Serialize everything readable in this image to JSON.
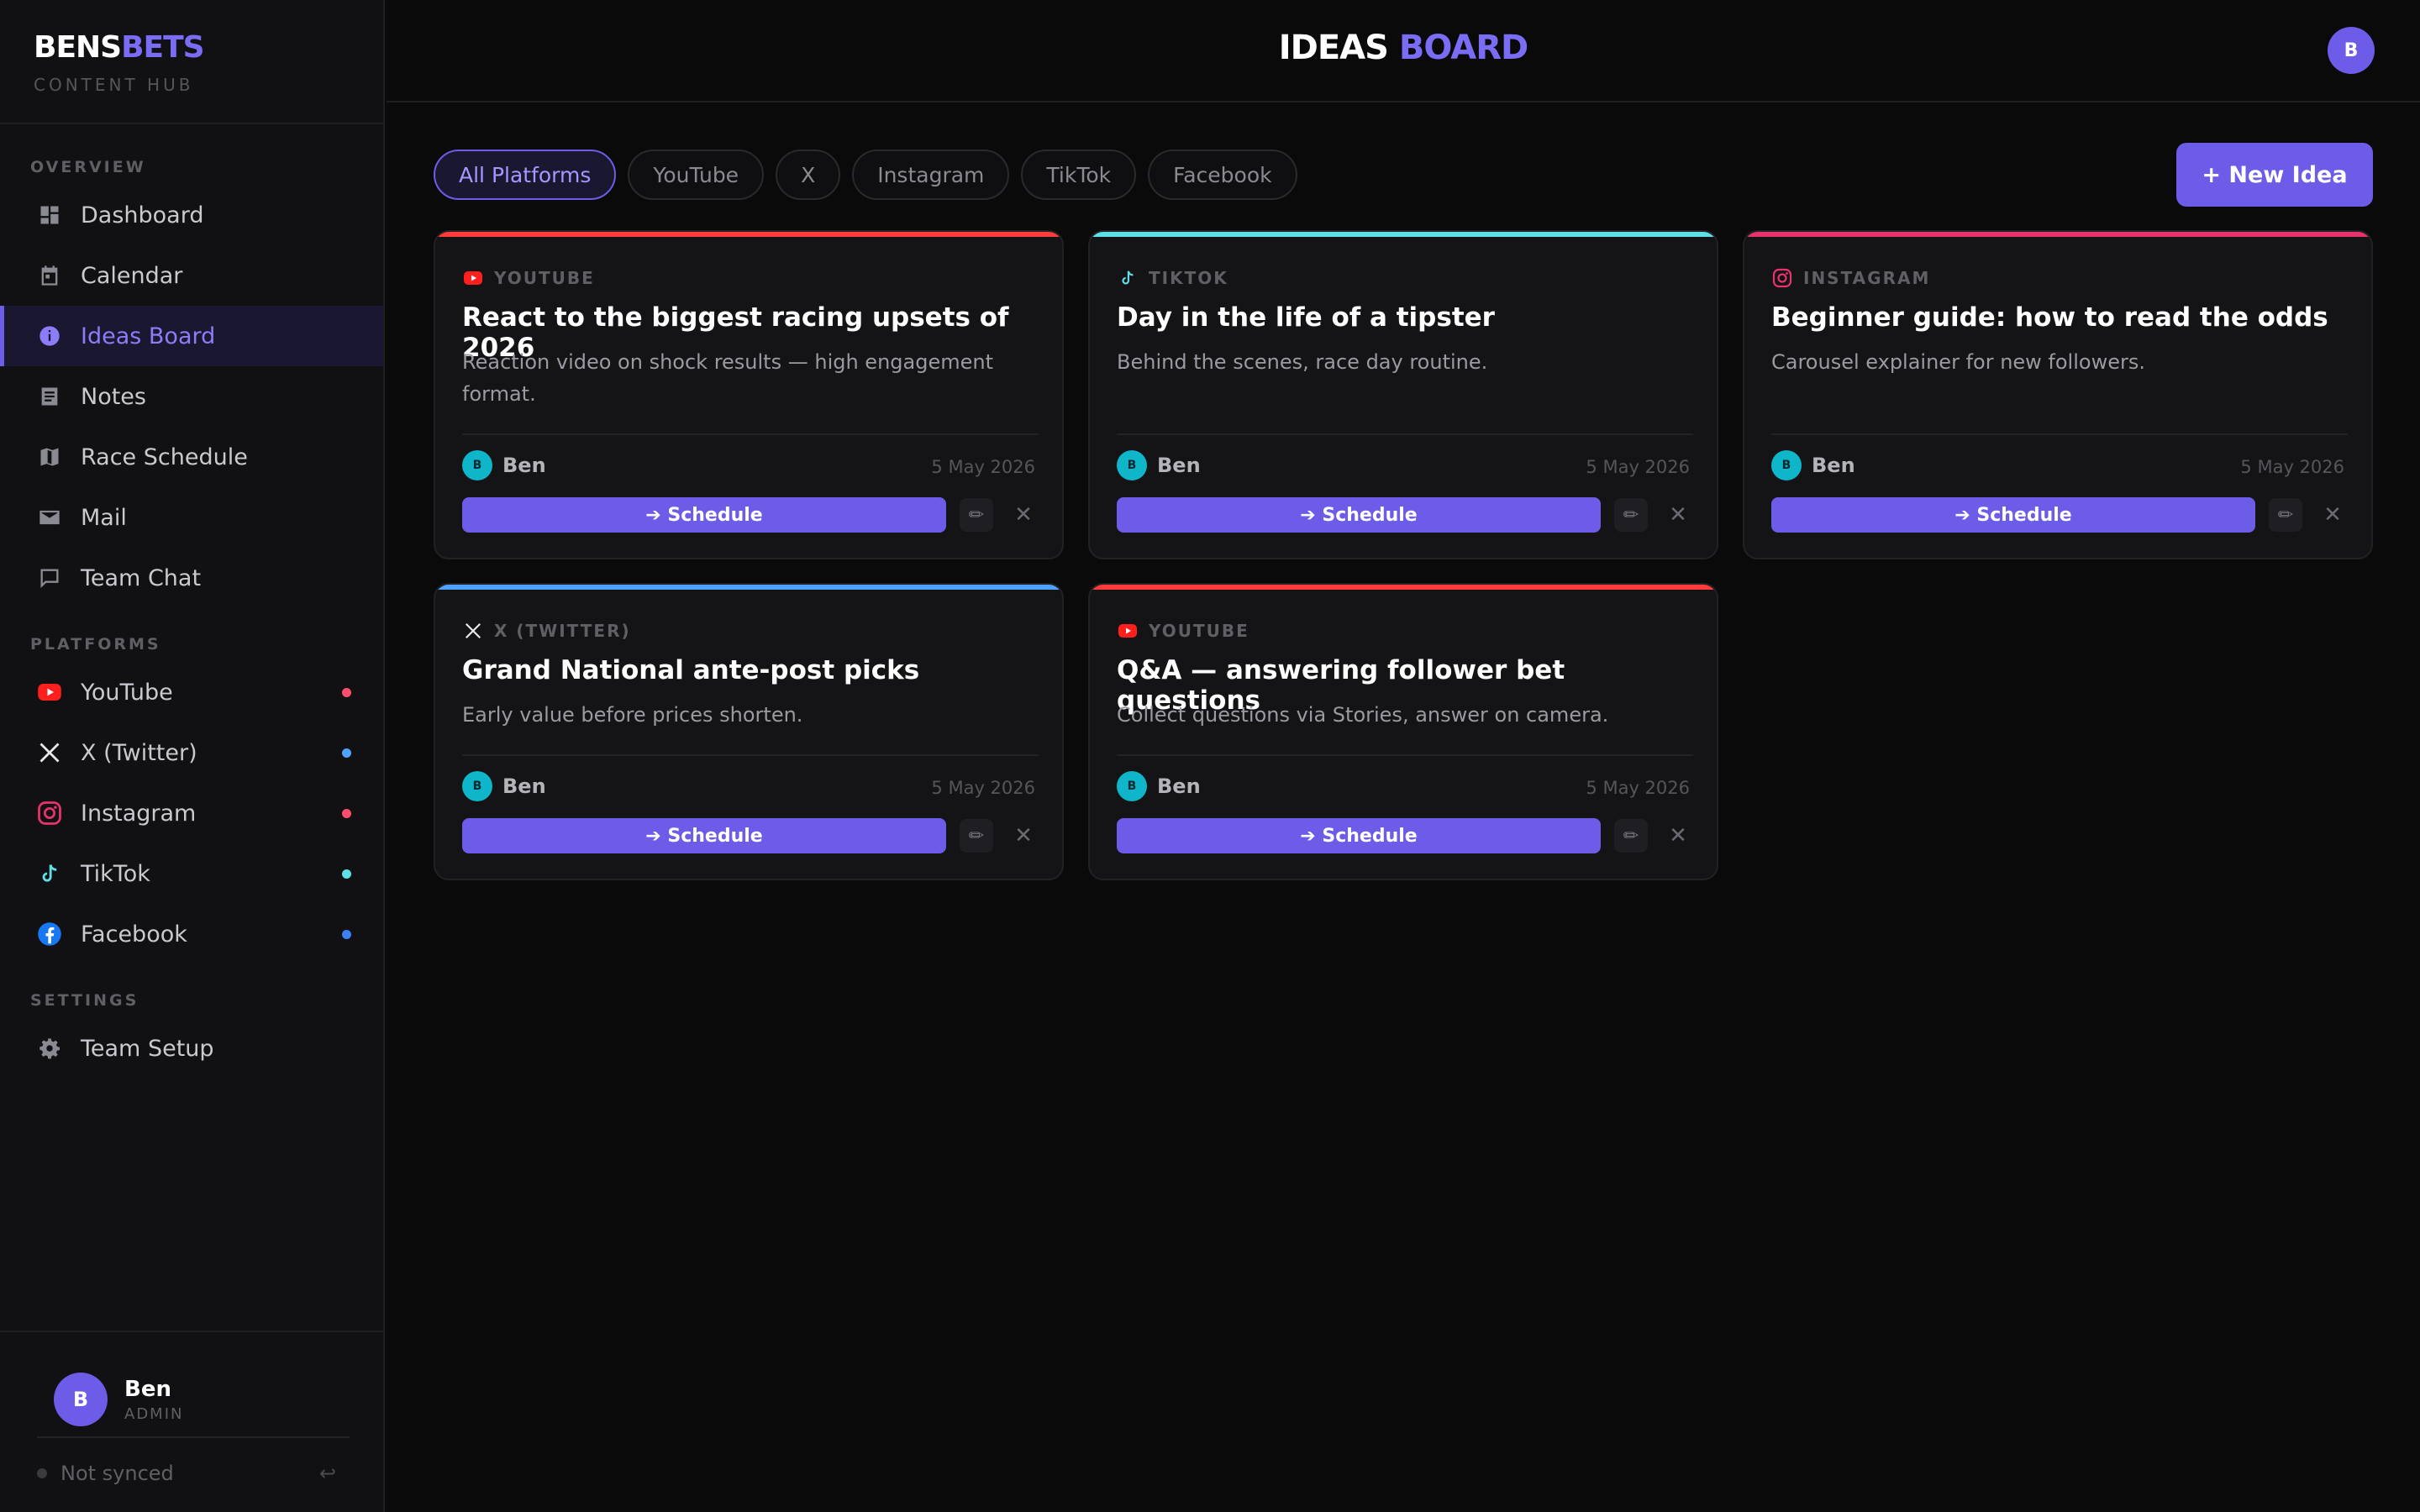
{
  "brand": {
    "name_a": "BENS",
    "name_b": "BETS",
    "subtitle": "CONTENT HUB"
  },
  "sidebar": {
    "sections": {
      "overview": "OVERVIEW",
      "platforms": "PLATFORMS",
      "settings": "SETTINGS"
    },
    "overview_items": [
      {
        "label": "Dashboard",
        "icon": "dashboard-icon"
      },
      {
        "label": "Calendar",
        "icon": "calendar-icon"
      },
      {
        "label": "Ideas Board",
        "icon": "info-icon",
        "active": true
      },
      {
        "label": "Notes",
        "icon": "notes-icon"
      },
      {
        "label": "Race Schedule",
        "icon": "map-icon"
      },
      {
        "label": "Mail",
        "icon": "mail-icon"
      },
      {
        "label": "Team Chat",
        "icon": "chat-icon"
      }
    ],
    "platform_items": [
      {
        "label": "YouTube",
        "icon": "youtube-icon",
        "dot_color": "#ff4d6d"
      },
      {
        "label": "X (Twitter)",
        "icon": "x-icon",
        "dot_color": "#4da3ff"
      },
      {
        "label": "Instagram",
        "icon": "instagram-icon",
        "dot_color": "#ff4d6d"
      },
      {
        "label": "TikTok",
        "icon": "tiktok-icon",
        "dot_color": "#5ee0e6"
      },
      {
        "label": "Facebook",
        "icon": "facebook-icon",
        "dot_color": "#3b82f6"
      }
    ],
    "settings_items": [
      {
        "label": "Team Setup",
        "icon": "gear-icon"
      }
    ],
    "user": {
      "initial": "B",
      "name": "Ben",
      "role": "ADMIN"
    },
    "sync_status": "Not synced"
  },
  "header": {
    "title_a": "IDEAS",
    "title_b": "BOARD",
    "avatar_initial": "B"
  },
  "filters": {
    "chips": [
      "All Platforms",
      "YouTube",
      "X",
      "Instagram",
      "TikTok",
      "Facebook"
    ],
    "active": "All Platforms"
  },
  "new_idea_label": "+ New Idea",
  "colors": {
    "accent": "#6c5ce7",
    "youtube": "#ff3b3b",
    "tiktok": "#5ee0e6",
    "instagram": "#e6336b",
    "x": "#4da3ff",
    "facebook": "#1877f2"
  },
  "cards": [
    {
      "platform": "YOUTUBE",
      "platform_icon": "youtube-icon",
      "top_color": "#ff3b3b",
      "title": "React to the biggest racing upsets of 2026",
      "description": "Reaction video on shock results — high engagement format.",
      "author_initial": "B",
      "author": "Ben",
      "date": "5 May 2026",
      "schedule_label": "➔ Schedule"
    },
    {
      "platform": "TIKTOK",
      "platform_icon": "tiktok-icon",
      "top_color": "#5ee0e6",
      "title": "Day in the life of a tipster",
      "description": "Behind the scenes, race day routine.",
      "author_initial": "B",
      "author": "Ben",
      "date": "5 May 2026",
      "schedule_label": "➔ Schedule"
    },
    {
      "platform": "INSTAGRAM",
      "platform_icon": "instagram-icon",
      "top_color": "#e6336b",
      "title": "Beginner guide: how to read the odds",
      "description": "Carousel explainer for new followers.",
      "author_initial": "B",
      "author": "Ben",
      "date": "5 May 2026",
      "schedule_label": "➔ Schedule"
    },
    {
      "platform": "X (TWITTER)",
      "platform_icon": "x-icon",
      "top_color": "#4da3ff",
      "title": "Grand National ante-post picks",
      "description": "Early value before prices shorten.",
      "author_initial": "B",
      "author": "Ben",
      "date": "5 May 2026",
      "schedule_label": "➔ Schedule"
    },
    {
      "platform": "YOUTUBE",
      "platform_icon": "youtube-icon",
      "top_color": "#ff3b3b",
      "title": "Q&A — answering follower bet questions",
      "description": "Collect questions via Stories, answer on camera.",
      "author_initial": "B",
      "author": "Ben",
      "date": "5 May 2026",
      "schedule_label": "➔ Schedule"
    }
  ]
}
